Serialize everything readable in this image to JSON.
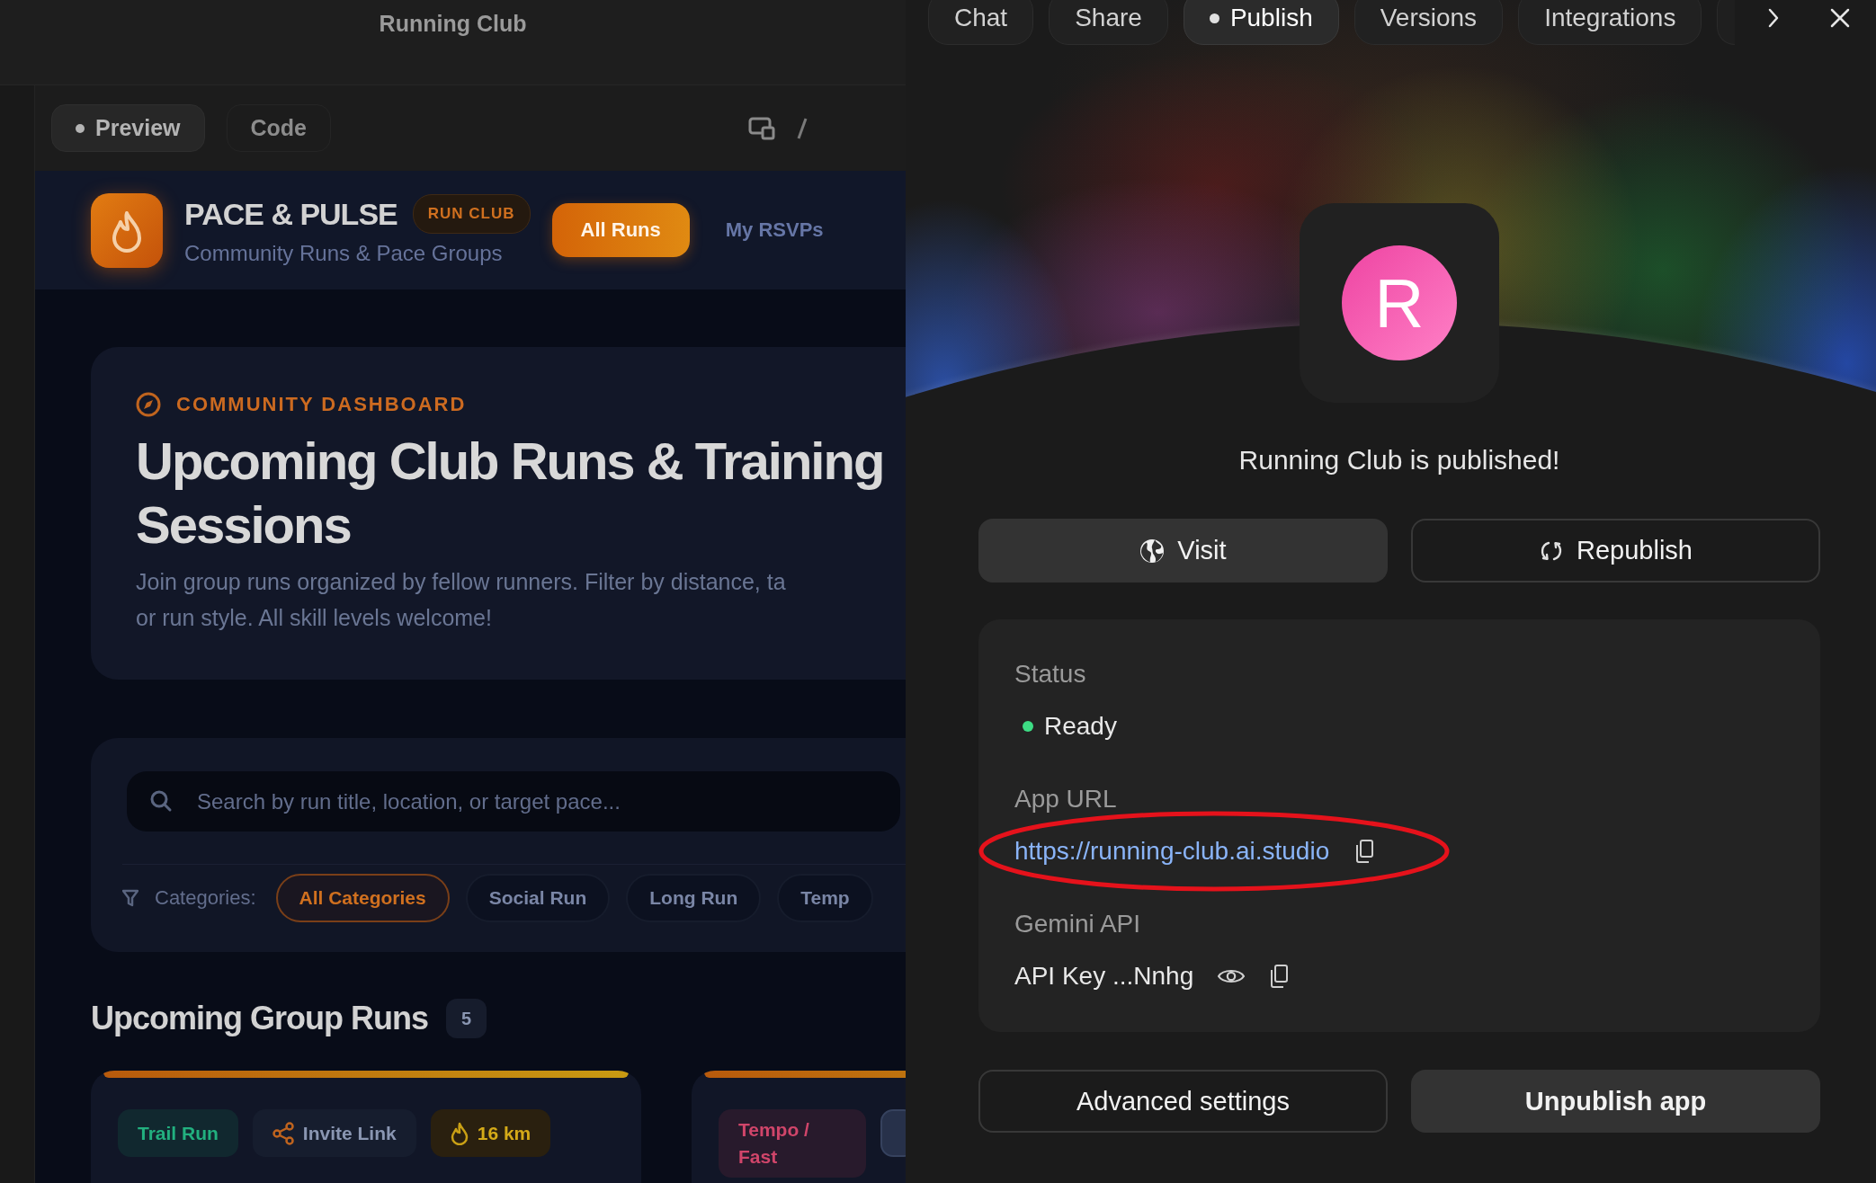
{
  "preview_window": {
    "title": "Running Club",
    "tabs": [
      {
        "label": "Preview",
        "selected": true
      },
      {
        "label": "Code",
        "selected": false
      }
    ]
  },
  "app": {
    "brand": "PACE & PULSE",
    "badge": "RUN CLUB",
    "tagline": "Community Runs & Pace Groups",
    "nav": [
      {
        "label": "All Runs",
        "selected": true
      },
      {
        "label": "My RSVPs",
        "selected": false
      }
    ],
    "hero": {
      "eyebrow": "COMMUNITY DASHBOARD",
      "title": "Upcoming Club Runs & Training Sessions",
      "description_lines": [
        "Join group runs organized by fellow runners. Filter by distance, ta",
        "or run style. All skill levels welcome!"
      ]
    },
    "filters": {
      "search": {
        "placeholder": "Search by run title, location, or target pace..."
      },
      "categories_label": "Categories:",
      "categories": [
        {
          "label": "All Categories",
          "selected": true
        },
        {
          "label": "Social Run",
          "selected": false
        },
        {
          "label": "Long Run",
          "selected": false
        },
        {
          "label": "Temp",
          "selected": false
        }
      ]
    },
    "runs": {
      "title": "Upcoming Group Runs",
      "count": "5",
      "cards": [
        {
          "tags": [
            {
              "kind": "category",
              "label": "Trail Run",
              "color": "#22b07f"
            },
            {
              "kind": "share",
              "label": "Invite Link"
            },
            {
              "kind": "distance",
              "label": "16 km"
            }
          ],
          "more_tags_hidden": false
        },
        {
          "tags": [
            {
              "kind": "category",
              "label": "Tempo / Fast",
              "color": "#d0456a"
            }
          ],
          "more_tags_hidden": true
        }
      ]
    }
  },
  "panel": {
    "tabs": [
      {
        "label": "Chat",
        "selected": false
      },
      {
        "label": "Share",
        "selected": false
      },
      {
        "label": "Publish",
        "selected": true
      },
      {
        "label": "Versions",
        "selected": false
      },
      {
        "label": "Integrations",
        "selected": false
      }
    ],
    "more_tabs_hidden": true
  },
  "publish": {
    "app_initial": "R",
    "message": "Running Club is published!",
    "actions": [
      {
        "kind": "visit",
        "label": "Visit"
      },
      {
        "kind": "republish",
        "label": "Republish"
      }
    ],
    "status": {
      "label": "Status",
      "value": "Ready",
      "color": "#3ddc84"
    },
    "app_url": {
      "label": "App URL",
      "url": "https://running-club.ai.studio",
      "highlighted": true
    },
    "gemini_api": {
      "label": "Gemini API",
      "key": "API Key ...Nnhg"
    },
    "footer_actions": [
      {
        "kind": "outline",
        "label": "Advanced settings"
      },
      {
        "kind": "filled",
        "label": "Unpublish app"
      }
    ]
  }
}
